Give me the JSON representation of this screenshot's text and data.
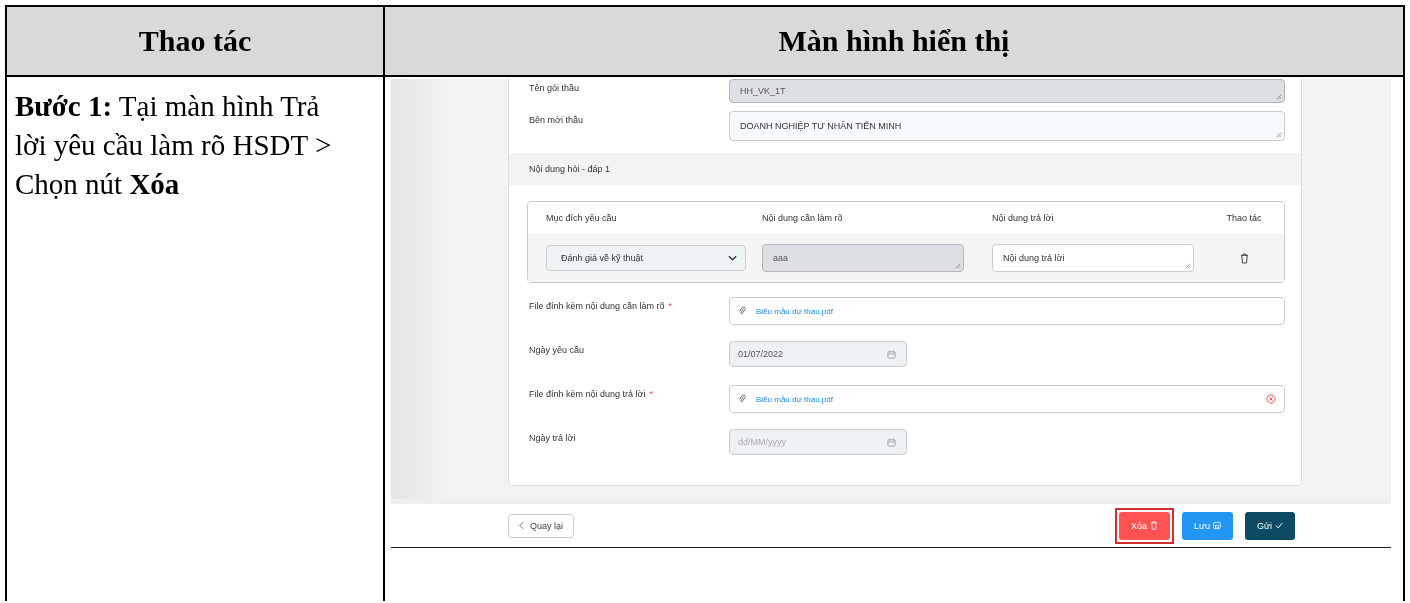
{
  "table": {
    "columns": [
      "Thao tác",
      "Màn hình hiển thị"
    ],
    "step": "**Bước 1:** Tại màn hình Trả lời yêu cầu làm rõ HSDT > Chọn nút **Xóa**"
  },
  "screen": {
    "top_fields": [
      {
        "label": "Tên gói thầu",
        "value": "HH_VK_1T",
        "disabled": true
      },
      {
        "label": "Bên mời thầu",
        "value": "DOANH NGHIỆP TƯ NHÂN TIẾN MINH",
        "disabled": false
      }
    ],
    "section_title": "Nội dung hỏi - đáp 1",
    "qa_table": {
      "columns": [
        "Mục đích yêu cầu",
        "Nội dung cần làm rõ",
        "Nội dung trả lời",
        "Thao tác"
      ],
      "rows": [
        {
          "purpose": "Đánh giá về kỹ thuật",
          "content": "aaa",
          "answer_placeholder": "Nội dung trả lời"
        }
      ]
    },
    "form_fields": [
      {
        "kind": "file",
        "label": "File đính kèm nội dung cần làm rõ",
        "required_mark": "*",
        "value": "Biểu mẫu dự thầu.pdf",
        "removable": false
      },
      {
        "kind": "date",
        "label": "Ngày yêu cầu",
        "value": "01/07/2022"
      },
      {
        "kind": "file",
        "label": "File đính kèm nội dung trả lời",
        "required_mark": "*",
        "value": "Biểu mẫu dự thầu.pdf",
        "removable": true
      },
      {
        "kind": "date",
        "label": "Ngày trả lời",
        "placeholder": "dd/MM/yyyy"
      }
    ],
    "back_button": "Quay lại",
    "actions": [
      {
        "kind": "delete",
        "label": "Xóa",
        "highlighted": true
      },
      {
        "kind": "save",
        "label": "Lưu",
        "highlighted": false
      },
      {
        "kind": "send",
        "label": "Gửi",
        "highlighted": false
      }
    ]
  }
}
